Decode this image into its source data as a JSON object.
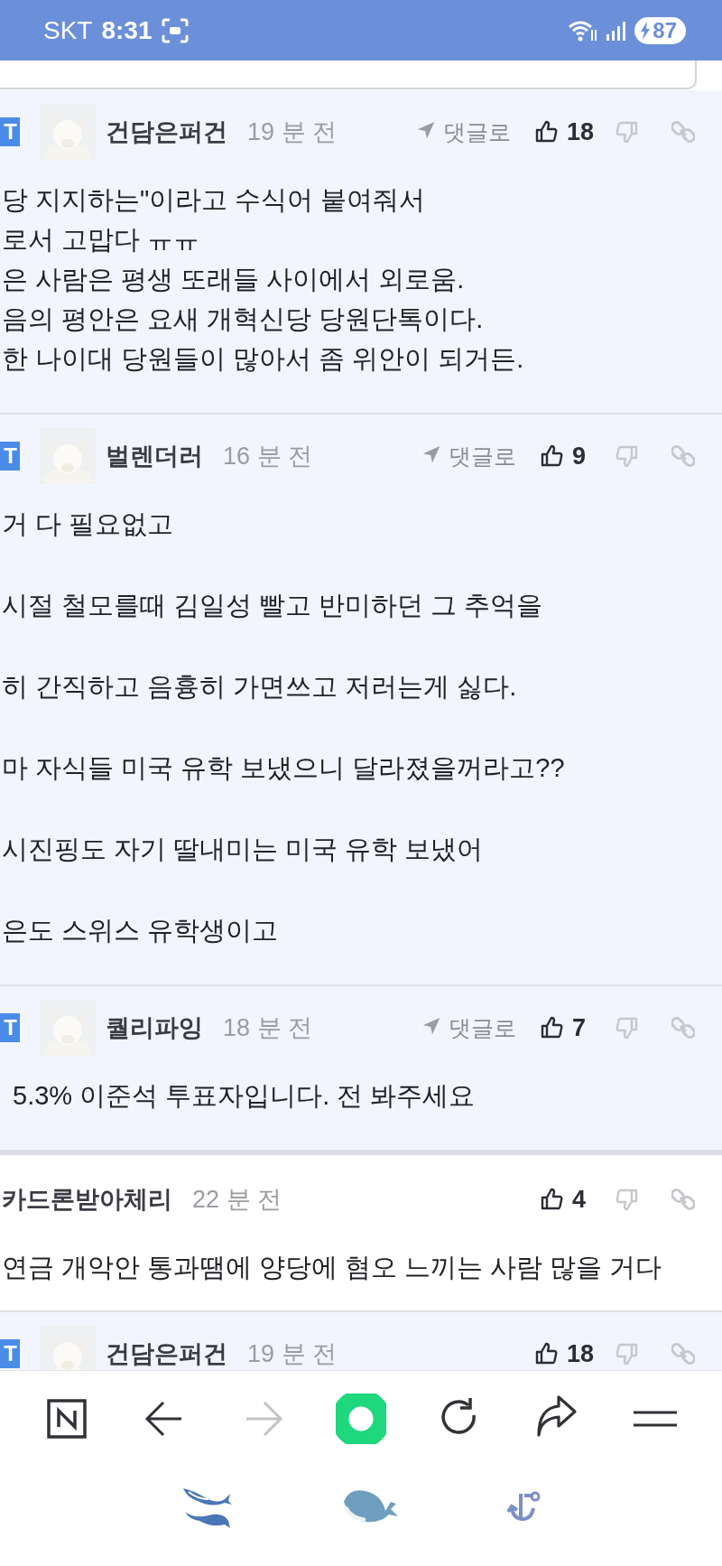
{
  "status_bar": {
    "carrier": "SKT",
    "time": "8:31",
    "battery": "87"
  },
  "comments": [
    {
      "highlighted": true,
      "badge": "T",
      "avatar": {
        "kind": "picture"
      },
      "author": "건담은퍼건",
      "time": "19 분 전",
      "reply_label": "댓글로",
      "likes": "18",
      "paragraphs": [
        [
          "당 지지하는\"이라고 수식어 붙여줘서",
          "로서 고맙다 ㅠㅠ",
          "은 사람은 평생 또래들 사이에서 외로움.",
          "음의 평안은 요새 개혁신당 당원단톡이다.",
          "한 나이대 당원들이 많아서 좀 위안이 되거든."
        ]
      ]
    },
    {
      "highlighted": true,
      "badge": "T",
      "avatar": {
        "kind": "picture"
      },
      "author": "벌렌더러",
      "time": "16 분 전",
      "reply_label": "댓글로",
      "likes": "9",
      "paragraphs": [
        [
          "거 다 필요없고"
        ],
        [
          "시절 철모를때 김일성 빨고 반미하던 그 추억을"
        ],
        [
          "히 간직하고 음흉히 가면쓰고 저러는게 싫다."
        ],
        [
          "마 자식들 미국 유학 보냈으니 달라졌을꺼라고??"
        ],
        [
          "시진핑도 자기 딸내미는 미국 유학 보냈어"
        ],
        [
          "은도 스위스 유학생이고"
        ]
      ]
    },
    {
      "highlighted": true,
      "badge": "T",
      "avatar": {
        "kind": "picture"
      },
      "author": "퀄리파잉",
      "time": "18 분 전",
      "reply_label": "댓글로",
      "likes": "7",
      "paragraphs": [
        [
          "5.3% 이준석 투표자입니다. 전 봐주세요"
        ]
      ]
    },
    {
      "highlighted": false,
      "author": "카드론받아체리",
      "time": "22 분 전",
      "likes": "4",
      "paragraphs": [
        [
          "연금 개악안 통과땜에 양당에 혐오 느끼는 사람 많을 거다"
        ]
      ]
    },
    {
      "highlighted": true,
      "badge": "T",
      "avatar": {
        "kind": "picture"
      },
      "author": "건담은퍼건",
      "time": "19 분 전",
      "likes": "18"
    }
  ],
  "toolbar": [
    {
      "kind": "home",
      "disabled": false
    },
    {
      "kind": "back",
      "disabled": false
    },
    {
      "kind": "forward",
      "disabled": true
    },
    {
      "kind": "green",
      "disabled": false
    },
    {
      "kind": "reload",
      "disabled": false
    },
    {
      "kind": "share",
      "disabled": false
    },
    {
      "kind": "menu",
      "disabled": false
    }
  ]
}
